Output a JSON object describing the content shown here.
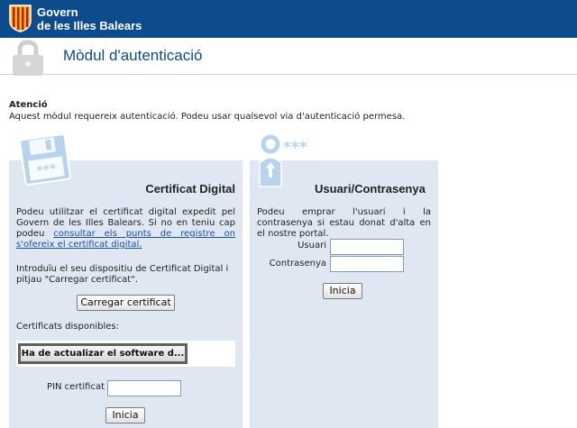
{
  "brand": {
    "line1": "Govern",
    "line2": "de les Illes Balears",
    "colors": {
      "top_bar": "#0e4b8c",
      "panel_bg": "#dfe8f2",
      "title": "#0e4b8c"
    }
  },
  "header": {
    "title": "Mòdul d'autenticació",
    "icon": "lock-icon"
  },
  "notice": {
    "title": "Atenció",
    "text": "Aquest mòdul requereix autenticació. Podeu usar qualsevol via d'autenticació permesa."
  },
  "certificate_panel": {
    "icon": "floppy-icon",
    "title": "Certificat Digital",
    "intro_text": "Podeu utilitzar el certificat digital expedit pel Govern de les Illes Balears. Si no en teniu cap podeu ",
    "intro_link": "consultar els punts de registre on s'ofereix el certificat digital.",
    "instructions": "Introduïu el seu dispositiu de Certificat Digital i pitjau \"Carregar certificat\".",
    "load_button": "Carregar certificat",
    "available_label": "Certificats disponibles:",
    "software_button": "Ha de actualizar el software d...",
    "pin_label": "PIN certificat",
    "pin_value": "",
    "login_button": "Inicia"
  },
  "password_panel": {
    "icon": "user-key-icon",
    "title": "Usuari/Contrasenya",
    "intro_text": "Podeu emprar l'usuari i la contrasenya si estau donat d'alta en el nostre portal.",
    "user_label": "Usuari",
    "user_value": "",
    "password_label": "Contrasenya",
    "password_value": "",
    "login_button": "Inicia"
  }
}
